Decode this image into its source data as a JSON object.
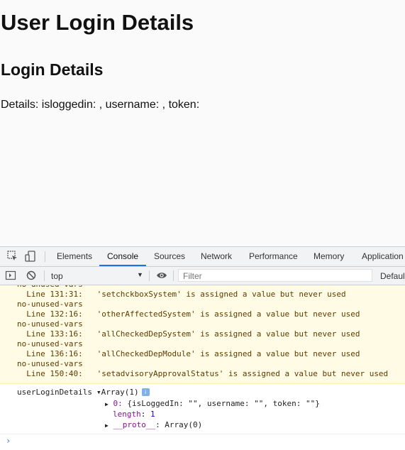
{
  "page": {
    "title": "User Login Details",
    "subtitle": "Login Details",
    "details_text": "Details: isloggedin: , username: , token:"
  },
  "devtools": {
    "tabs": [
      {
        "label": "Elements",
        "active": false
      },
      {
        "label": "Console",
        "active": true
      },
      {
        "label": "Sources",
        "active": false
      },
      {
        "label": "Network",
        "active": false
      },
      {
        "label": "Performance",
        "active": false
      },
      {
        "label": "Memory",
        "active": false
      },
      {
        "label": "Application",
        "active": false
      }
    ],
    "toolbar": {
      "context": "top",
      "filter_placeholder": "Filter",
      "levels": "Default levels"
    },
    "warnings": [
      "no-unused-vars",
      "  Line 131:31:   'setchckboxSystem' is assigned a value but never used",
      "no-unused-vars",
      "  Line 132:16:   'otherAffectedSystem' is assigned a value but never used",
      "no-unused-vars",
      "  Line 133:16:   'allCheckedDepSystem' is assigned a value but never used",
      "no-unused-vars",
      "  Line 136:16:   'allCheckedDepModule' is assigned a value but never used",
      "no-unused-vars",
      "  Line 150:40:   'setadvisoryApprovalStatus' is assigned a value but never used"
    ],
    "log": {
      "label": "userLoginDetails",
      "array_summary": "Array(1)",
      "info_badge": "i",
      "item0_prefix": "0: ",
      "item0_text": "{isLoggedIn: \"\", username: \"\", token: \"\"}",
      "length_key": "length",
      "length_value": "1",
      "proto_key": "__proto__",
      "proto_value": ": Array(0)"
    },
    "prompt_symbol": "›"
  },
  "colors": {
    "active_tab": "#1a73e8",
    "warning_bg": "#fffbe5",
    "warning_text": "#5c3b00",
    "key_purple": "#881391",
    "number_blue": "#1c00cf"
  }
}
